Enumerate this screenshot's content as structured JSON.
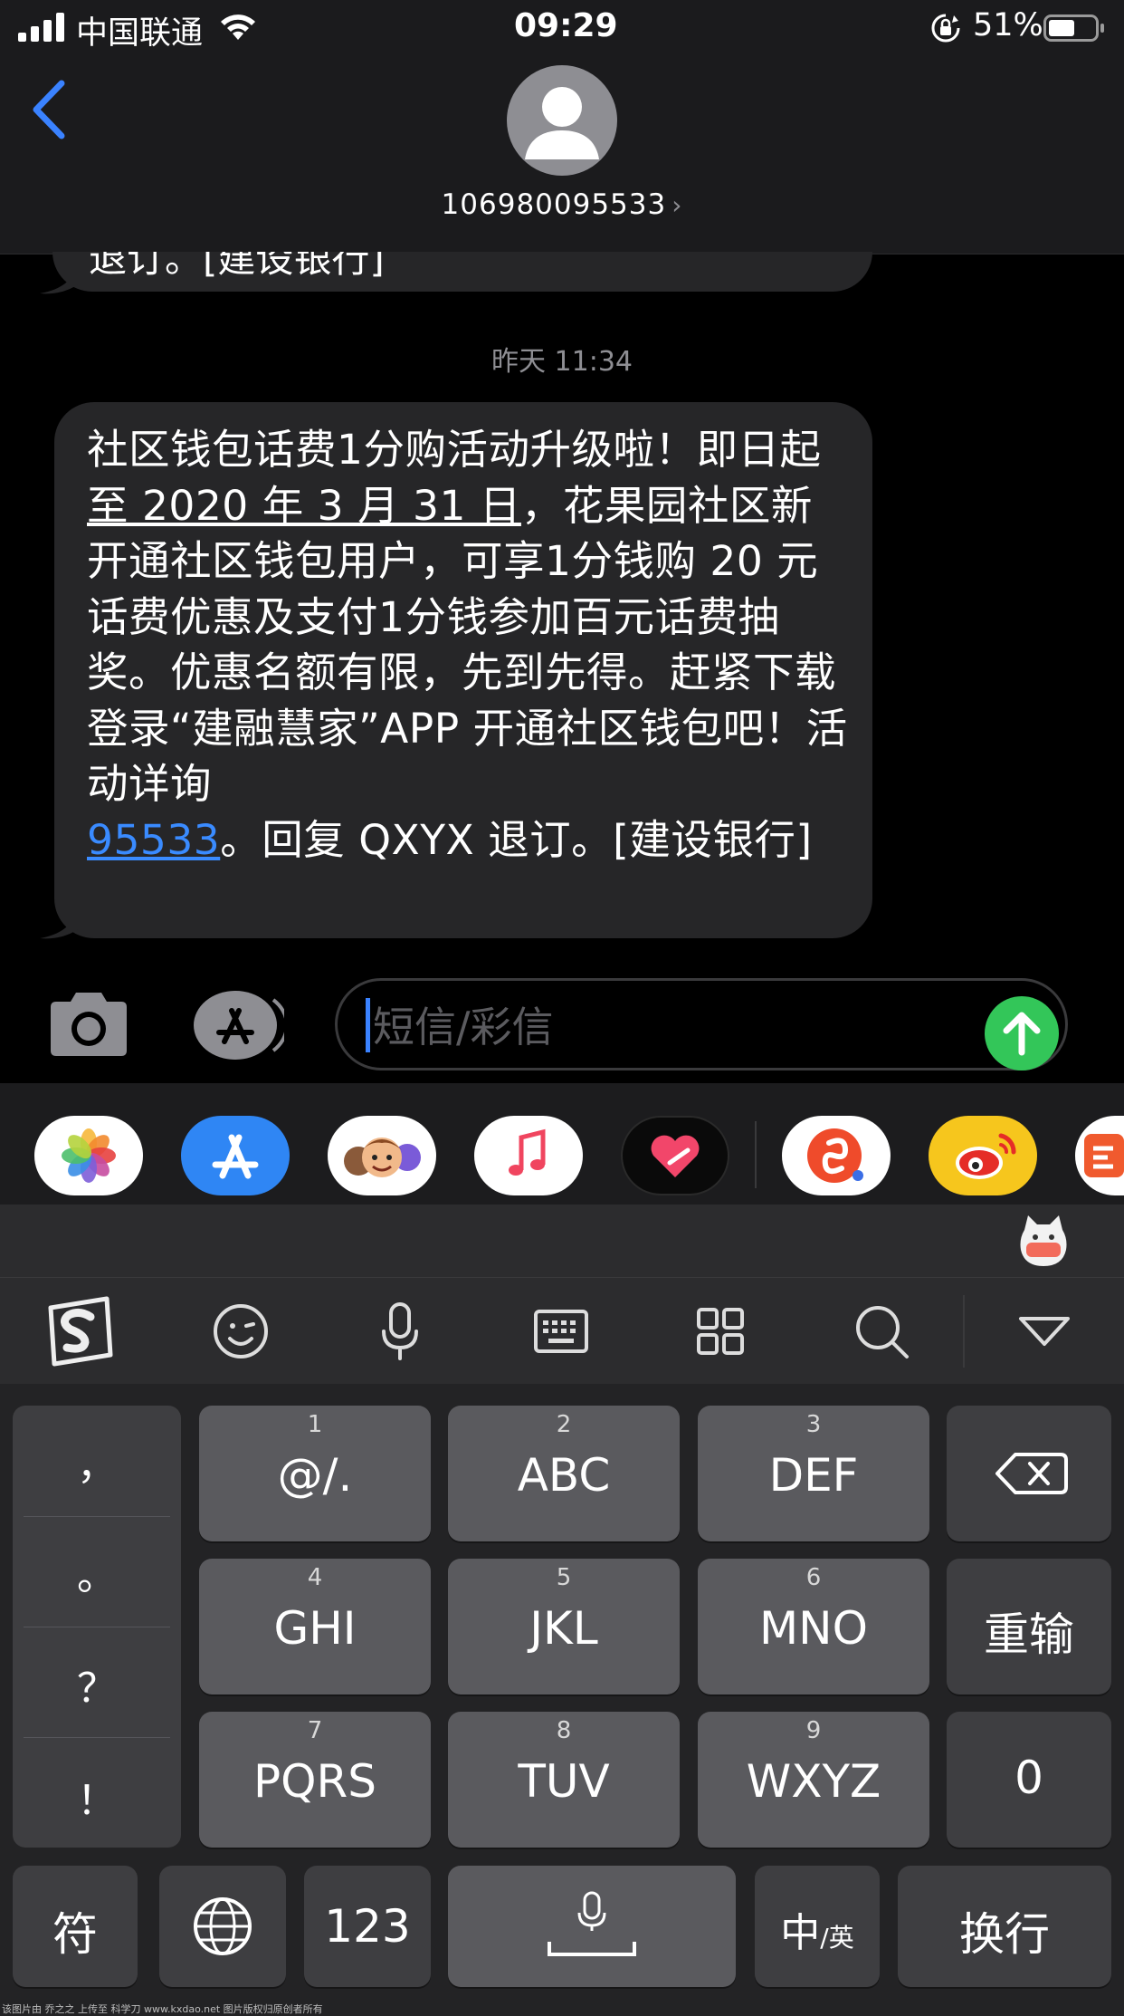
{
  "status_bar": {
    "carrier": "中国联通",
    "time": "09:29",
    "battery_pct": "51%",
    "icons": [
      "signal-icon",
      "wifi-icon",
      "orientation-lock-icon",
      "battery-icon"
    ]
  },
  "header": {
    "contact": "106980095533",
    "chevron": "›"
  },
  "messages": {
    "prev_fragment": "退订。[建设银行]",
    "timestamp": "昨天 11:34",
    "body_part1": "社区钱包话费1分购活动升级啦！即日起",
    "body_date": "至 2020 年 3 月 31 日",
    "body_part2": "，花果园社区新开通社区钱包用户，可享1分钱购 20 元话费优惠及支付1分钱参加百元话费抽奖。优惠名额有限，先到先得。赶紧下载登录“建融慧家”APP 开通社区钱包吧！活动详询",
    "body_phone": "95533",
    "body_part3": "。回复 QXYX 退订。[建设银行]"
  },
  "input": {
    "placeholder": "短信/彩信"
  },
  "app_strip": [
    "photos-app-icon",
    "app-store-app-icon",
    "memoji-app-icon",
    "music-app-icon",
    "digital-touch-app-icon",
    "shazam-like-app-icon",
    "weibo-app-icon",
    "partial-app-icon"
  ],
  "keyboard_toolbar": [
    "sogou-logo-icon",
    "emoji-icon",
    "microphone-icon",
    "keyboard-icon",
    "grid-icon",
    "search-icon",
    "collapse-icon"
  ],
  "keyboard": {
    "punct": [
      "，",
      "。",
      "？",
      "！"
    ],
    "keys": [
      {
        "num": "1",
        "label": "@/."
      },
      {
        "num": "2",
        "label": "ABC"
      },
      {
        "num": "3",
        "label": "DEF"
      },
      {
        "num": "4",
        "label": "GHI"
      },
      {
        "num": "5",
        "label": "JKL"
      },
      {
        "num": "6",
        "label": "MNO"
      },
      {
        "num": "7",
        "label": "PQRS"
      },
      {
        "num": "8",
        "label": "TUV"
      },
      {
        "num": "9",
        "label": "WXYZ"
      }
    ],
    "reenter": "重输",
    "zero": "0",
    "symbols": "符",
    "numbers": "123",
    "lang_main": "中",
    "lang_sub": "/英",
    "newline": "换行"
  },
  "watermark": "该图片由 乔之之 上传至 科学刀 www.kxdao.net 图片版权归原创者所有"
}
